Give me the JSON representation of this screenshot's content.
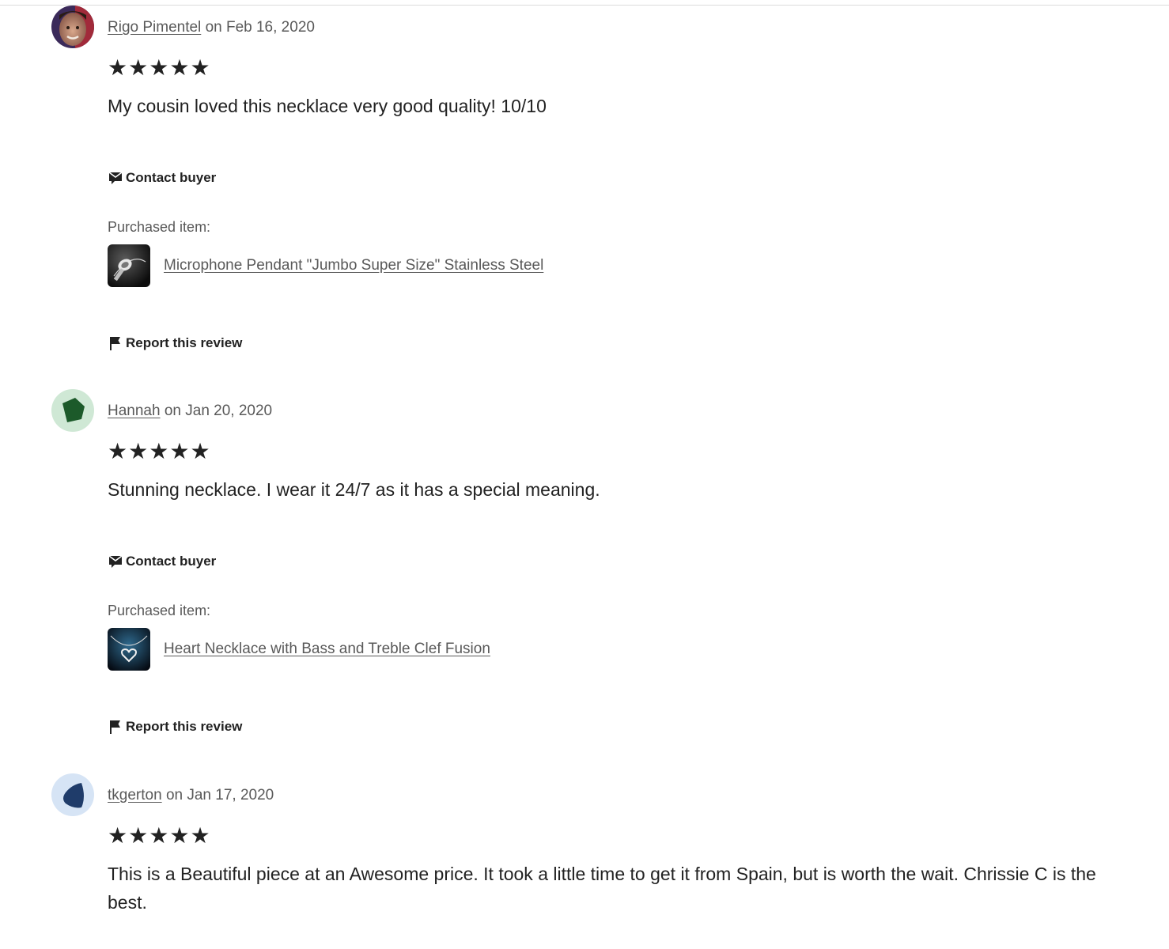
{
  "colors": {
    "text_primary": "#222222",
    "text_secondary": "#595959",
    "rule": "#dcdcdc"
  },
  "reviews": [
    {
      "reviewer": "Rigo Pimentel",
      "date_text": "on Feb 16, 2020",
      "rating": 5,
      "text": "My cousin loved this necklace very good quality! 10/10",
      "avatar": "photo-avatar",
      "contact_label": "Contact buyer",
      "purchased_label": "Purchased item:",
      "item_name": "Microphone Pendant \"Jumbo Super Size\" Stainless Steel",
      "item_thumb": "microphone-pendant-thumbnail",
      "report_label": "Report this review"
    },
    {
      "reviewer": "Hannah",
      "date_text": "on Jan 20, 2020",
      "rating": 5,
      "text": "Stunning necklace. I wear it 24/7 as it has a special meaning.",
      "avatar": "green-pentagon-avatar",
      "contact_label": "Contact buyer",
      "purchased_label": "Purchased item:",
      "item_name": "Heart Necklace with Bass and Treble Clef Fusion",
      "item_thumb": "heart-necklace-thumbnail",
      "report_label": "Report this review"
    },
    {
      "reviewer": "tkgerton",
      "date_text": "on Jan 17, 2020",
      "rating": 5,
      "text": "This is a Beautiful piece at an Awesome price. It took a little time to get it from Spain, but is worth the wait. Chrissie C is the best.",
      "avatar": "blue-shape-avatar"
    }
  ],
  "icons": {
    "contact": "message-icon",
    "report": "flag-icon",
    "star": "star-icon"
  }
}
